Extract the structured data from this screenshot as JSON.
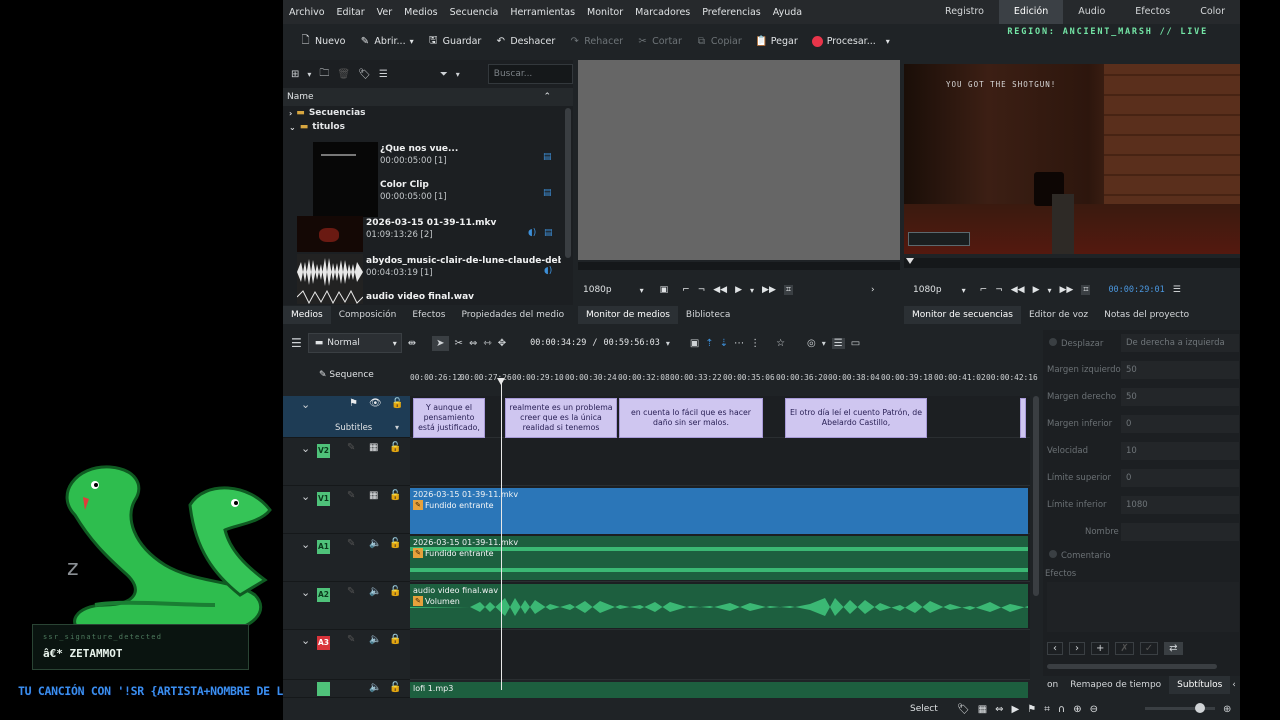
{
  "menu": [
    "Archivo",
    "Editar",
    "Ver",
    "Medios",
    "Secuencia",
    "Herramientas",
    "Monitor",
    "Marcadores",
    "Preferencias",
    "Ayuda"
  ],
  "layouts": [
    {
      "label": "Registro",
      "active": false
    },
    {
      "label": "Edición",
      "active": true
    },
    {
      "label": "Audio",
      "active": false
    },
    {
      "label": "Efectos",
      "active": false
    },
    {
      "label": "Color",
      "active": false
    }
  ],
  "toolbar": {
    "new": "Nuevo",
    "open": "Abrir...",
    "save": "Guardar",
    "undo": "Deshacer",
    "redo": "Rehacer",
    "cut": "Cortar",
    "copy": "Copiar",
    "paste": "Pegar",
    "render": "Procesar..."
  },
  "region_text": "REGION: ANCIENT_MARSH // LIVE",
  "bin": {
    "search_placeholder": "Buscar...",
    "column_name": "Name",
    "folders": [
      "Secuencias",
      "titulos"
    ],
    "clips": [
      {
        "name": "¿Que nos vue...",
        "duration": "00:00:05:00 [1]"
      },
      {
        "name": "Color Clip",
        "duration": "00:00:05:00 [1]"
      },
      {
        "name": "2026-03-15 01-39-11.mkv",
        "duration": "01:09:13:26 [2]"
      },
      {
        "name": "abydos_music-clair-de-lune-claude-debussy-mo",
        "duration": "00:04:03:19 [1]"
      },
      {
        "name": "audio video final.wav",
        "duration": ""
      }
    ],
    "tabs": [
      "Medios",
      "Composición",
      "Efectos",
      "Propiedades del medio"
    ]
  },
  "clip_monitor": {
    "resolution": "1080p",
    "tabs": [
      "Monitor de medios",
      "Biblioteca"
    ]
  },
  "project_monitor": {
    "resolution": "1080p",
    "timecode": "00:00:29:01",
    "tabs": [
      "Monitor de secuencias",
      "Editor de voz",
      "Notas del proyecto"
    ],
    "game_message": "YOU GOT THE SHOTGUN!"
  },
  "timeline": {
    "mode": "Normal",
    "position": "00:00:34:29",
    "duration": "00:59:56:03",
    "sequence_label": "Sequence",
    "ruler": [
      "00:00:26:12",
      "00:00:27:26",
      "00:00:29:10",
      "00:00:30:24",
      "00:00:32:08",
      "00:00:33:22",
      "00:00:35:06",
      "00:00:36:20",
      "00:00:38:04",
      "00:00:39:18",
      "00:00:41:02",
      "00:00:42:16"
    ],
    "subtitles_label": "Subtitles",
    "subtitles": [
      "Y aunque el pensamiento está justificado,",
      "realmente es un problema creer que es la única realidad si tenemos",
      "en cuenta lo fácil que es hacer daño sin ser malos.",
      "El otro día leí el cuento Patrón, de Abelardo Castillo,"
    ],
    "tracks": {
      "v2": "V2",
      "v1": "V1",
      "a1": "A1",
      "a2": "A2",
      "a3": "A3",
      "v1_clip": "2026-03-15 01-39-11.mkv",
      "v1_fx": "Fundido entrante",
      "a1_clip": "2026-03-15 01-39-11.mkv",
      "a1_fx": "Fundido entrante",
      "a2_clip": "audio video final.wav",
      "a2_fx": "Volumen",
      "a4_clip": "lofi 1.mp3"
    }
  },
  "effect_panel": {
    "fields": [
      {
        "label": "Desplazar",
        "value": "De derecha a izquierda"
      },
      {
        "label": "Margen izquierdo",
        "value": "50"
      },
      {
        "label": "Margen derecho",
        "value": "50"
      },
      {
        "label": "Margen inferior",
        "value": "0"
      },
      {
        "label": "Velocidad",
        "value": "10"
      },
      {
        "label": "Límite superior",
        "value": "0"
      },
      {
        "label": "Límite inferior",
        "value": "1080"
      },
      {
        "label": "Nombre",
        "value": ""
      }
    ],
    "comment_label": "Comentario",
    "effects_label": "Efectos",
    "tabs": [
      "Remapeo de tiempo",
      "Subtítulos"
    ],
    "tab_prefix": "on"
  },
  "status": {
    "select": "Select"
  },
  "overlay": {
    "signature_label": "ssr_signature_detected",
    "signature_name": "â€* ZETAMMOT",
    "caption": "TU CANCIÓN CON '!SR {ARTISTA+NOMBRE DE LA CANCIÓN}'"
  },
  "colors": {
    "accent_blue": "#3d8fd8",
    "track_green": "#4fc27a",
    "track_red": "#d9343b",
    "subtitle_fill": "#cfc6f0",
    "video_clip": "#2b76b8",
    "audio_clip": "#1d5f3f",
    "caption_blue": "#3a8ff0",
    "region_green": "#74e6a6"
  }
}
